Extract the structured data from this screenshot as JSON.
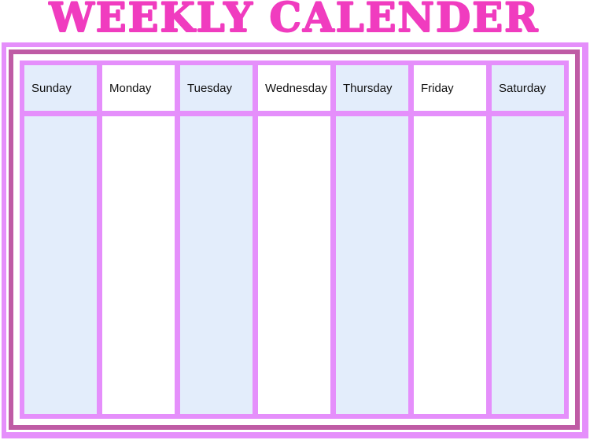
{
  "page": {
    "title": "WEEKLY CALENDER",
    "kind": "printable-weekly-calendar-template"
  },
  "colors": {
    "title_outline": "#f03cbf",
    "frame_outer": "#e58ffb",
    "frame_middle": "#bf5ba5",
    "grid_line": "#e58ffb",
    "cell_tinted": "#e3edfb",
    "cell_plain": "#ffffff",
    "label_text": "#111111"
  },
  "calendar": {
    "columns": [
      {
        "label": "Sunday",
        "tinted": true,
        "content": ""
      },
      {
        "label": "Monday",
        "tinted": false,
        "content": ""
      },
      {
        "label": "Tuesday",
        "tinted": true,
        "content": ""
      },
      {
        "label": "Wednesday",
        "tinted": false,
        "content": ""
      },
      {
        "label": "Thursday",
        "tinted": true,
        "content": ""
      },
      {
        "label": "Friday",
        "tinted": false,
        "content": ""
      },
      {
        "label": "Saturday",
        "tinted": true,
        "content": ""
      }
    ]
  }
}
